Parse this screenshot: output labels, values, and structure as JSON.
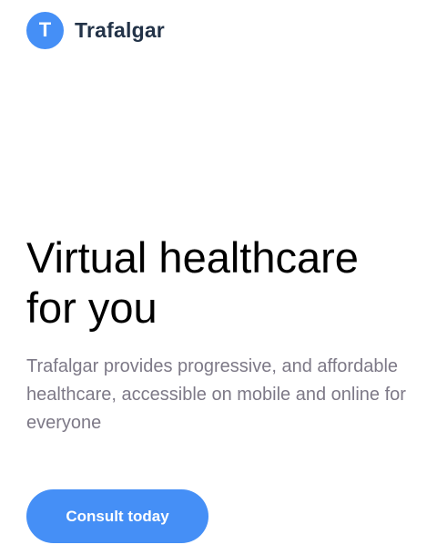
{
  "header": {
    "logo_letter": "T",
    "brand_name": "Trafalgar"
  },
  "hero": {
    "title_line1": "Virtual healthcare",
    "title_line2": "for you",
    "description": "Trafalgar provides progressive, and affordable healthcare, accessible on mobile and online for everyone"
  },
  "cta": {
    "label": "Consult today"
  },
  "colors": {
    "accent": "#458ff6",
    "brand_text": "#233348",
    "body_text": "#7d7987",
    "background": "#ffffff"
  }
}
